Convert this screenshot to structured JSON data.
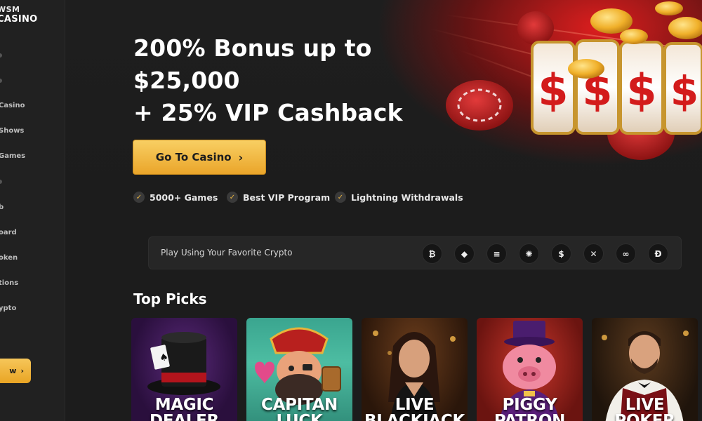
{
  "sidebar": {
    "logo_top": "WSM",
    "logo_bottom": "CASINO",
    "items": [
      {
        "label": "Casino"
      },
      {
        "label": "Shows"
      },
      {
        "label": "Games"
      },
      {
        "label": "b"
      },
      {
        "label": "oard"
      },
      {
        "label": "oken"
      },
      {
        "label": "tions"
      },
      {
        "label": "ypto"
      }
    ],
    "cta_label": "w"
  },
  "hero": {
    "headline_line1": "200% Bonus up to",
    "headline_line2": "$25,000",
    "headline_line3": "+ 25% VIP Cashback",
    "cta_label": "Go To Casino",
    "features": [
      {
        "label": "5000+ Games"
      },
      {
        "label": "Best VIP Program"
      },
      {
        "label": "Lightning Withdrawals"
      }
    ]
  },
  "crypto": {
    "label": "Play Using Your Favorite Crypto",
    "coins": [
      {
        "icon": "bitcoin-icon",
        "glyph": "₿"
      },
      {
        "icon": "ethereum-icon",
        "glyph": "◆"
      },
      {
        "icon": "solana-icon",
        "glyph": "≡"
      },
      {
        "icon": "cardano-icon",
        "glyph": "✺"
      },
      {
        "icon": "usdc-icon",
        "glyph": "$"
      },
      {
        "icon": "xrp-icon",
        "glyph": "✕"
      },
      {
        "icon": "chainlink-icon",
        "glyph": "∞"
      },
      {
        "icon": "dogecoin-icon",
        "glyph": "Đ"
      }
    ]
  },
  "top_picks": {
    "title": "Top Picks",
    "cards": [
      {
        "line1": "MAGIC",
        "line2": "DEALER"
      },
      {
        "line1": "CAPITAN",
        "line2": "LUCK"
      },
      {
        "line1": "LIVE",
        "line2": "BLACKJACK"
      },
      {
        "line1": "PIGGY",
        "line2": "PATRON"
      },
      {
        "line1": "LIVE",
        "line2": "POKER"
      }
    ]
  },
  "colors": {
    "accent_gold": "#f0b53f",
    "hero_red": "#d81e1e",
    "background": "#1c1c1c"
  }
}
